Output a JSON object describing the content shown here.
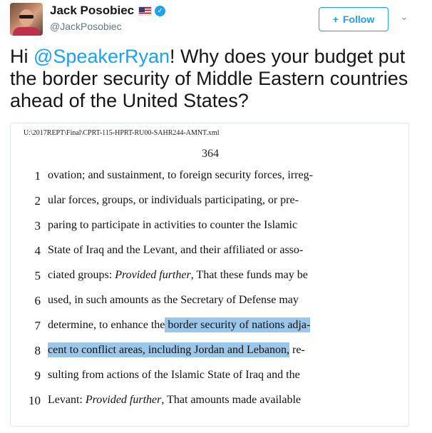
{
  "user": {
    "name": "Jack Posobiec",
    "handle": "@JackPosobiec",
    "verified_glyph": "✓"
  },
  "follow_button": {
    "icon": "+",
    "label": "Follow"
  },
  "caret_glyph": "⌄",
  "tweet": {
    "part1": "Hi ",
    "mention": "@SpeakerRyan",
    "part2": "! Why does your budget put the border security of Middle Eastern countries ahead of the United States?"
  },
  "document": {
    "header": "U:\\2017REPT\\Final\\CPRT-115-HPRT-RU00-SAHR244-AMNT.xml",
    "page_number": "364",
    "lines": [
      {
        "num": "1",
        "text": "ovation; and sustainment, to foreign security forces, irreg-"
      },
      {
        "num": "2",
        "text": "ular forces, groups, or individuals participating, or pre-"
      },
      {
        "num": "3",
        "text": "paring to participate in activities to counter the Islamic"
      },
      {
        "num": "4",
        "text": "State of Iraq and the Levant, and their affiliated or asso-"
      },
      {
        "num": "5",
        "a": "ciated groups: ",
        "em": "Provided further",
        "b": ", That these funds may be"
      },
      {
        "num": "6",
        "text": "used, in such amounts as the Secretary of Defense may"
      },
      {
        "num": "7",
        "a": "determine, to enhance the",
        "hl": " border security of nations adja-"
      },
      {
        "num": "8",
        "hl": "cent to conflict areas, including Jordan and Lebanon,",
        "b": " re-"
      },
      {
        "num": "9",
        "text": "sulting from actions of the Islamic State of Iraq and the"
      },
      {
        "num": "10",
        "a": "Levant: ",
        "em": "Provided further",
        "b": ", That amounts made available"
      }
    ]
  }
}
